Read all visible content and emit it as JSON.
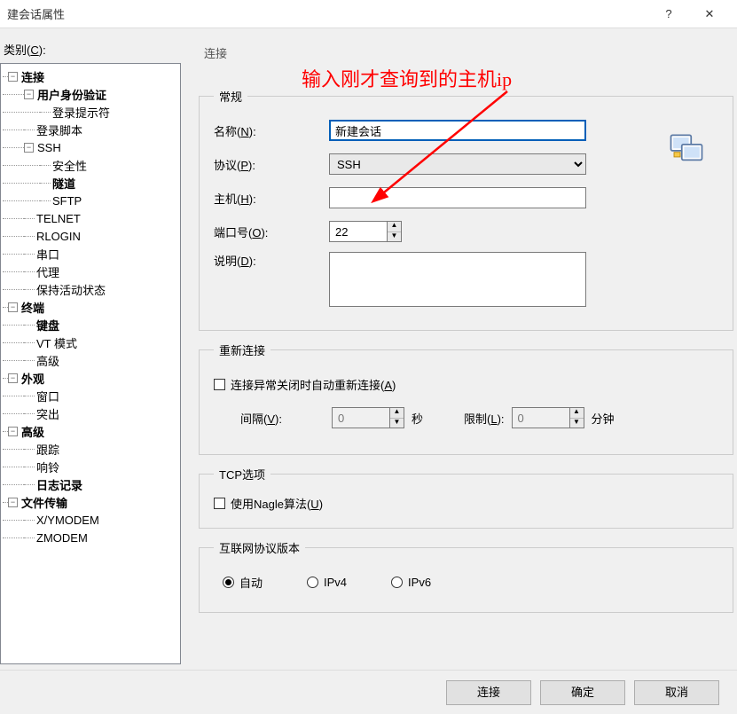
{
  "window": {
    "title": "建会话属性",
    "help": "?",
    "close": "✕"
  },
  "left": {
    "category_label": "类别(",
    "category_key": "C",
    "category_end": "):"
  },
  "annotation": "输入刚才查询到的主机ip",
  "tree": [
    {
      "depth": 0,
      "exp": "-",
      "bold": true,
      "label": "连接"
    },
    {
      "depth": 1,
      "exp": "-",
      "bold": true,
      "label": "用户身份验证"
    },
    {
      "depth": 2,
      "exp": "",
      "bold": false,
      "label": "登录提示符"
    },
    {
      "depth": 1,
      "exp": "",
      "bold": false,
      "label": "登录脚本"
    },
    {
      "depth": 1,
      "exp": "-",
      "bold": false,
      "label": "SSH"
    },
    {
      "depth": 2,
      "exp": "",
      "bold": false,
      "label": "安全性"
    },
    {
      "depth": 2,
      "exp": "",
      "bold": true,
      "label": "隧道"
    },
    {
      "depth": 2,
      "exp": "",
      "bold": false,
      "label": "SFTP"
    },
    {
      "depth": 1,
      "exp": "",
      "bold": false,
      "label": "TELNET"
    },
    {
      "depth": 1,
      "exp": "",
      "bold": false,
      "label": "RLOGIN"
    },
    {
      "depth": 1,
      "exp": "",
      "bold": false,
      "label": "串口"
    },
    {
      "depth": 1,
      "exp": "",
      "bold": false,
      "label": "代理"
    },
    {
      "depth": 1,
      "exp": "",
      "bold": false,
      "label": "保持活动状态"
    },
    {
      "depth": 0,
      "exp": "-",
      "bold": true,
      "label": "终端"
    },
    {
      "depth": 1,
      "exp": "",
      "bold": true,
      "label": "键盘"
    },
    {
      "depth": 1,
      "exp": "",
      "bold": false,
      "label": "VT 模式"
    },
    {
      "depth": 1,
      "exp": "",
      "bold": false,
      "label": "高级"
    },
    {
      "depth": 0,
      "exp": "-",
      "bold": true,
      "label": "外观"
    },
    {
      "depth": 1,
      "exp": "",
      "bold": false,
      "label": "窗口"
    },
    {
      "depth": 1,
      "exp": "",
      "bold": false,
      "label": "突出"
    },
    {
      "depth": 0,
      "exp": "-",
      "bold": true,
      "label": "高级"
    },
    {
      "depth": 1,
      "exp": "",
      "bold": false,
      "label": "跟踪"
    },
    {
      "depth": 1,
      "exp": "",
      "bold": false,
      "label": "响铃"
    },
    {
      "depth": 1,
      "exp": "",
      "bold": true,
      "label": "日志记录"
    },
    {
      "depth": 0,
      "exp": "-",
      "bold": true,
      "label": "文件传输"
    },
    {
      "depth": 1,
      "exp": "",
      "bold": false,
      "label": "X/YMODEM"
    },
    {
      "depth": 1,
      "exp": "",
      "bold": false,
      "label": "ZMODEM"
    }
  ],
  "panel": {
    "heading": "连接",
    "group_general": "常规",
    "name_lbl": "名称(",
    "name_key": "N",
    "name_val": "新建会话",
    "proto_lbl": "协议(",
    "proto_key": "P",
    "proto_val": "SSH",
    "host_lbl": "主机(",
    "host_key": "H",
    "host_val": "",
    "port_lbl": "端口号(",
    "port_key": "O",
    "port_val": "22",
    "desc_lbl": "说明(",
    "desc_key": "D",
    "desc_val": "",
    "group_reconn": "重新连接",
    "reconn_chk": "连接异常关闭时自动重新连接(",
    "reconn_key": "A",
    "interval_lbl": "间隔(",
    "interval_key": "V",
    "interval_val": "0",
    "seconds": "秒",
    "limit_lbl": "限制(",
    "limit_key": "L",
    "limit_val": "0",
    "minutes": "分钟",
    "group_tcp": "TCP选项",
    "nagle_chk": "使用Nagle算法(",
    "nagle_key": "U",
    "group_ipver": "互联网协议版本",
    "ip_auto": "自动",
    "ip_v4": "IPv4",
    "ip_v6": "IPv6"
  },
  "footer": {
    "connect": "连接",
    "ok": "确定",
    "cancel": "取消"
  },
  "lbl_close": "):"
}
